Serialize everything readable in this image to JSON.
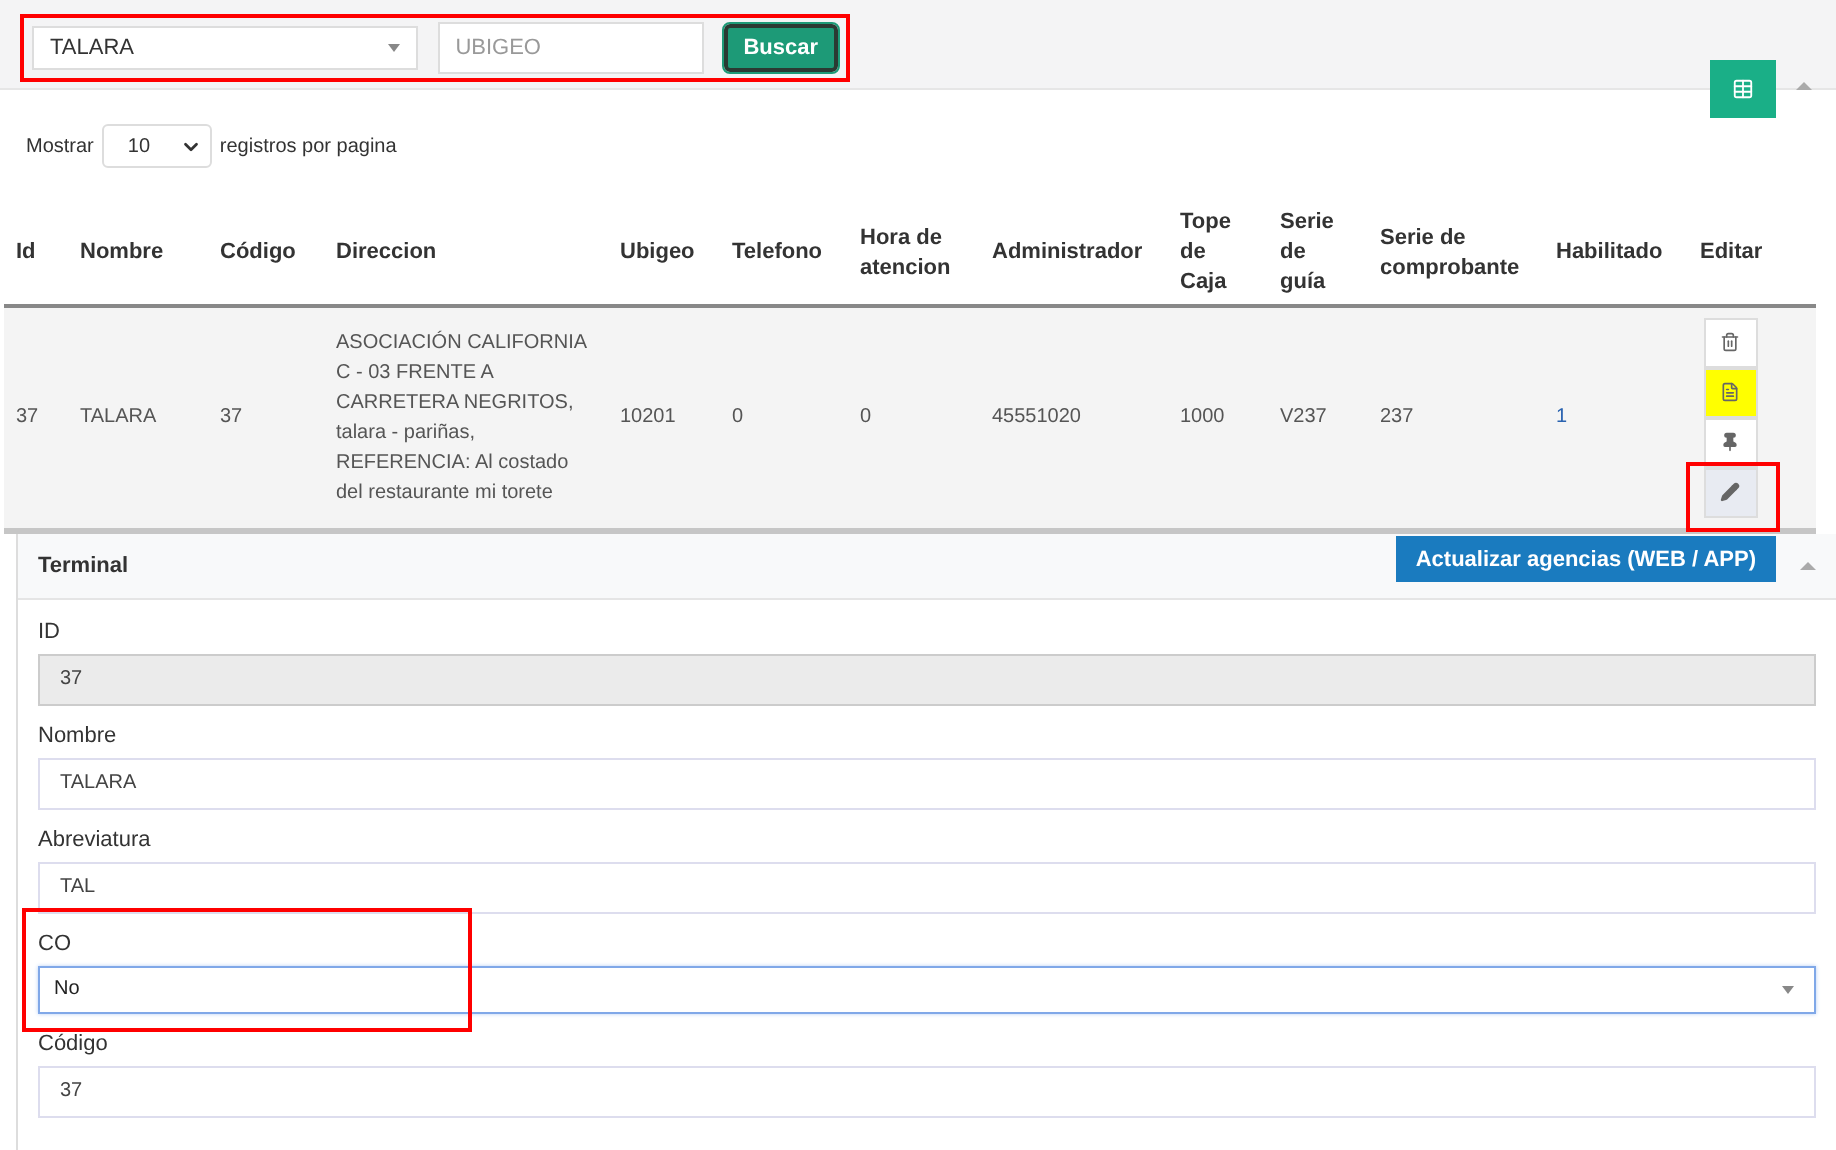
{
  "search": {
    "select_value": "TALARA",
    "placeholder": "UBIGEO",
    "button": "Buscar",
    "annotated": true
  },
  "page_size": {
    "label_before": "Mostrar",
    "value": "10",
    "label_after": "registros por pagina"
  },
  "table": {
    "columns": [
      "Id",
      "Nombre",
      "Código",
      "Direccion",
      "Ubigeo",
      "Telefono",
      "Hora de atencion",
      "Administrador",
      "Tope de Caja",
      "Serie de guía",
      "Serie de comprobante",
      "Habilitado",
      "Editar"
    ],
    "rows": [
      {
        "cells": [
          "37",
          "TALARA",
          "37",
          "ASOCIACIÓN CALIFORNIA C - 03 FRENTE A CARRETERA NEGRITOS, talara - pariñas, REFERENCIA: Al costado del restaurante mi torete",
          "10201",
          "0",
          "0",
          "45551020",
          "1000",
          "V237",
          "237",
          "1"
        ],
        "actions": [
          {
            "kind": "delete",
            "color": "#ffffff",
            "annotated": false
          },
          {
            "kind": "document",
            "color": "#ffff00",
            "annotated": false
          },
          {
            "kind": "pin",
            "color": "#ffffff",
            "annotated": false
          },
          {
            "kind": "edit",
            "color": "#e8ebf2",
            "annotated": true
          }
        ]
      }
    ]
  },
  "form": {
    "title": "Terminal",
    "button": "Actualizar agencias (WEB / APP)",
    "fields": [
      {
        "kind": "text",
        "label": "ID",
        "value": "37",
        "disabled": true,
        "annotated": false
      },
      {
        "kind": "text",
        "label": "Nombre",
        "value": "TALARA",
        "disabled": false,
        "annotated": false
      },
      {
        "kind": "text",
        "label": "Abreviatura",
        "value": "TAL",
        "disabled": false,
        "annotated": false
      },
      {
        "kind": "select",
        "label": "CO",
        "value": "No",
        "disabled": false,
        "annotated": true
      },
      {
        "kind": "text",
        "label": "Código",
        "value": "37",
        "disabled": false,
        "annotated": false
      }
    ]
  }
}
